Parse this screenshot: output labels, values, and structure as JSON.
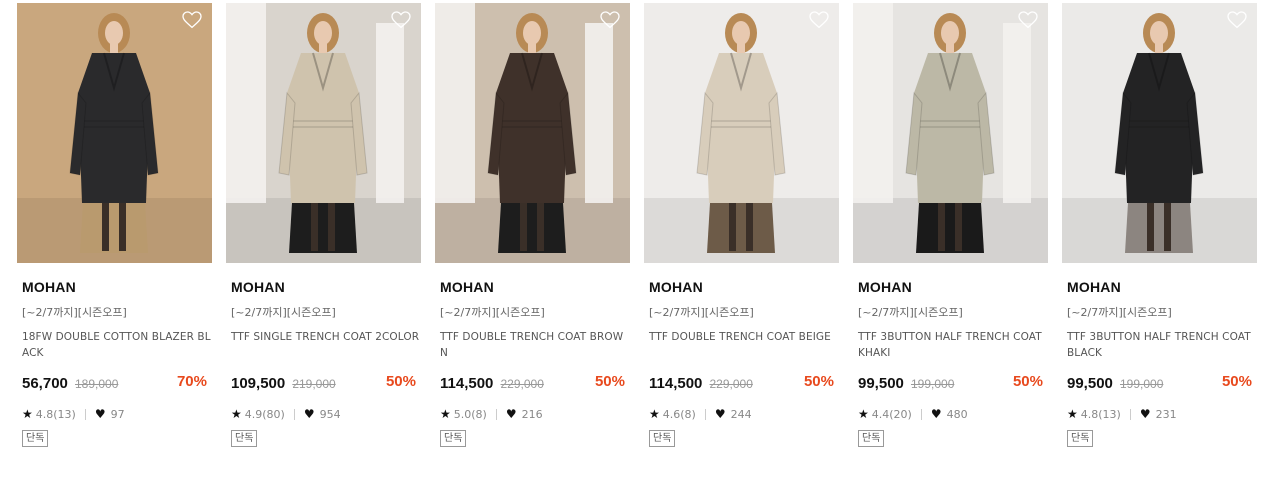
{
  "products": [
    {
      "brand": "MOHAN",
      "promo": "[~2/7까지][시즌오프]",
      "name": "18FW DOUBLE COTTON BLAZER BLACK",
      "price": "56,700",
      "original_price": "189,000",
      "discount": "70%",
      "rating": "4.8(13)",
      "likes": "97",
      "badge": "단독",
      "colors": {
        "bg": "#c9a77e",
        "coat": "#2a2a2c",
        "skirt": "#b99a6e"
      }
    },
    {
      "brand": "MOHAN",
      "promo": "[~2/7까지][시즌오프]",
      "name": "TTF SINGLE TRENCH COAT 2COLOR",
      "price": "109,500",
      "original_price": "219,000",
      "discount": "50%",
      "rating": "4.9(80)",
      "likes": "954",
      "badge": "단독",
      "colors": {
        "bg": "#d9d4cd",
        "coat": "#cfc3ad",
        "skirt": "#1d1d1d"
      }
    },
    {
      "brand": "MOHAN",
      "promo": "[~2/7까지][시즌오프]",
      "name": "TTF DOUBLE TRENCH COAT BROWN",
      "price": "114,500",
      "original_price": "229,000",
      "discount": "50%",
      "rating": "5.0(8)",
      "likes": "216",
      "badge": "단독",
      "colors": {
        "bg": "#cdbfae",
        "coat": "#3f312a",
        "skirt": "#1d1d1d"
      }
    },
    {
      "brand": "MOHAN",
      "promo": "[~2/7까지][시즌오프]",
      "name": "TTF DOUBLE TRENCH COAT BEIGE",
      "price": "114,500",
      "original_price": "229,000",
      "discount": "50%",
      "rating": "4.6(8)",
      "likes": "244",
      "badge": "단독",
      "colors": {
        "bg": "#eeecea",
        "coat": "#d8cdbb",
        "skirt": "#6d5b48"
      }
    },
    {
      "brand": "MOHAN",
      "promo": "[~2/7까지][시즌오프]",
      "name": "TTF 3BUTTON HALF TRENCH COAT KHAKI",
      "price": "99,500",
      "original_price": "199,000",
      "discount": "50%",
      "rating": "4.4(20)",
      "likes": "480",
      "badge": "단독",
      "colors": {
        "bg": "#e6e4e1",
        "coat": "#bcb8a6",
        "skirt": "#1a1a1a"
      }
    },
    {
      "brand": "MOHAN",
      "promo": "[~2/7까지][시즌오프]",
      "name": "TTF 3BUTTON HALF TRENCH COAT BLACK",
      "price": "99,500",
      "original_price": "199,000",
      "discount": "50%",
      "rating": "4.8(13)",
      "likes": "231",
      "badge": "단독",
      "colors": {
        "bg": "#ebeae8",
        "coat": "#232324",
        "skirt": "#8c8580"
      }
    }
  ]
}
